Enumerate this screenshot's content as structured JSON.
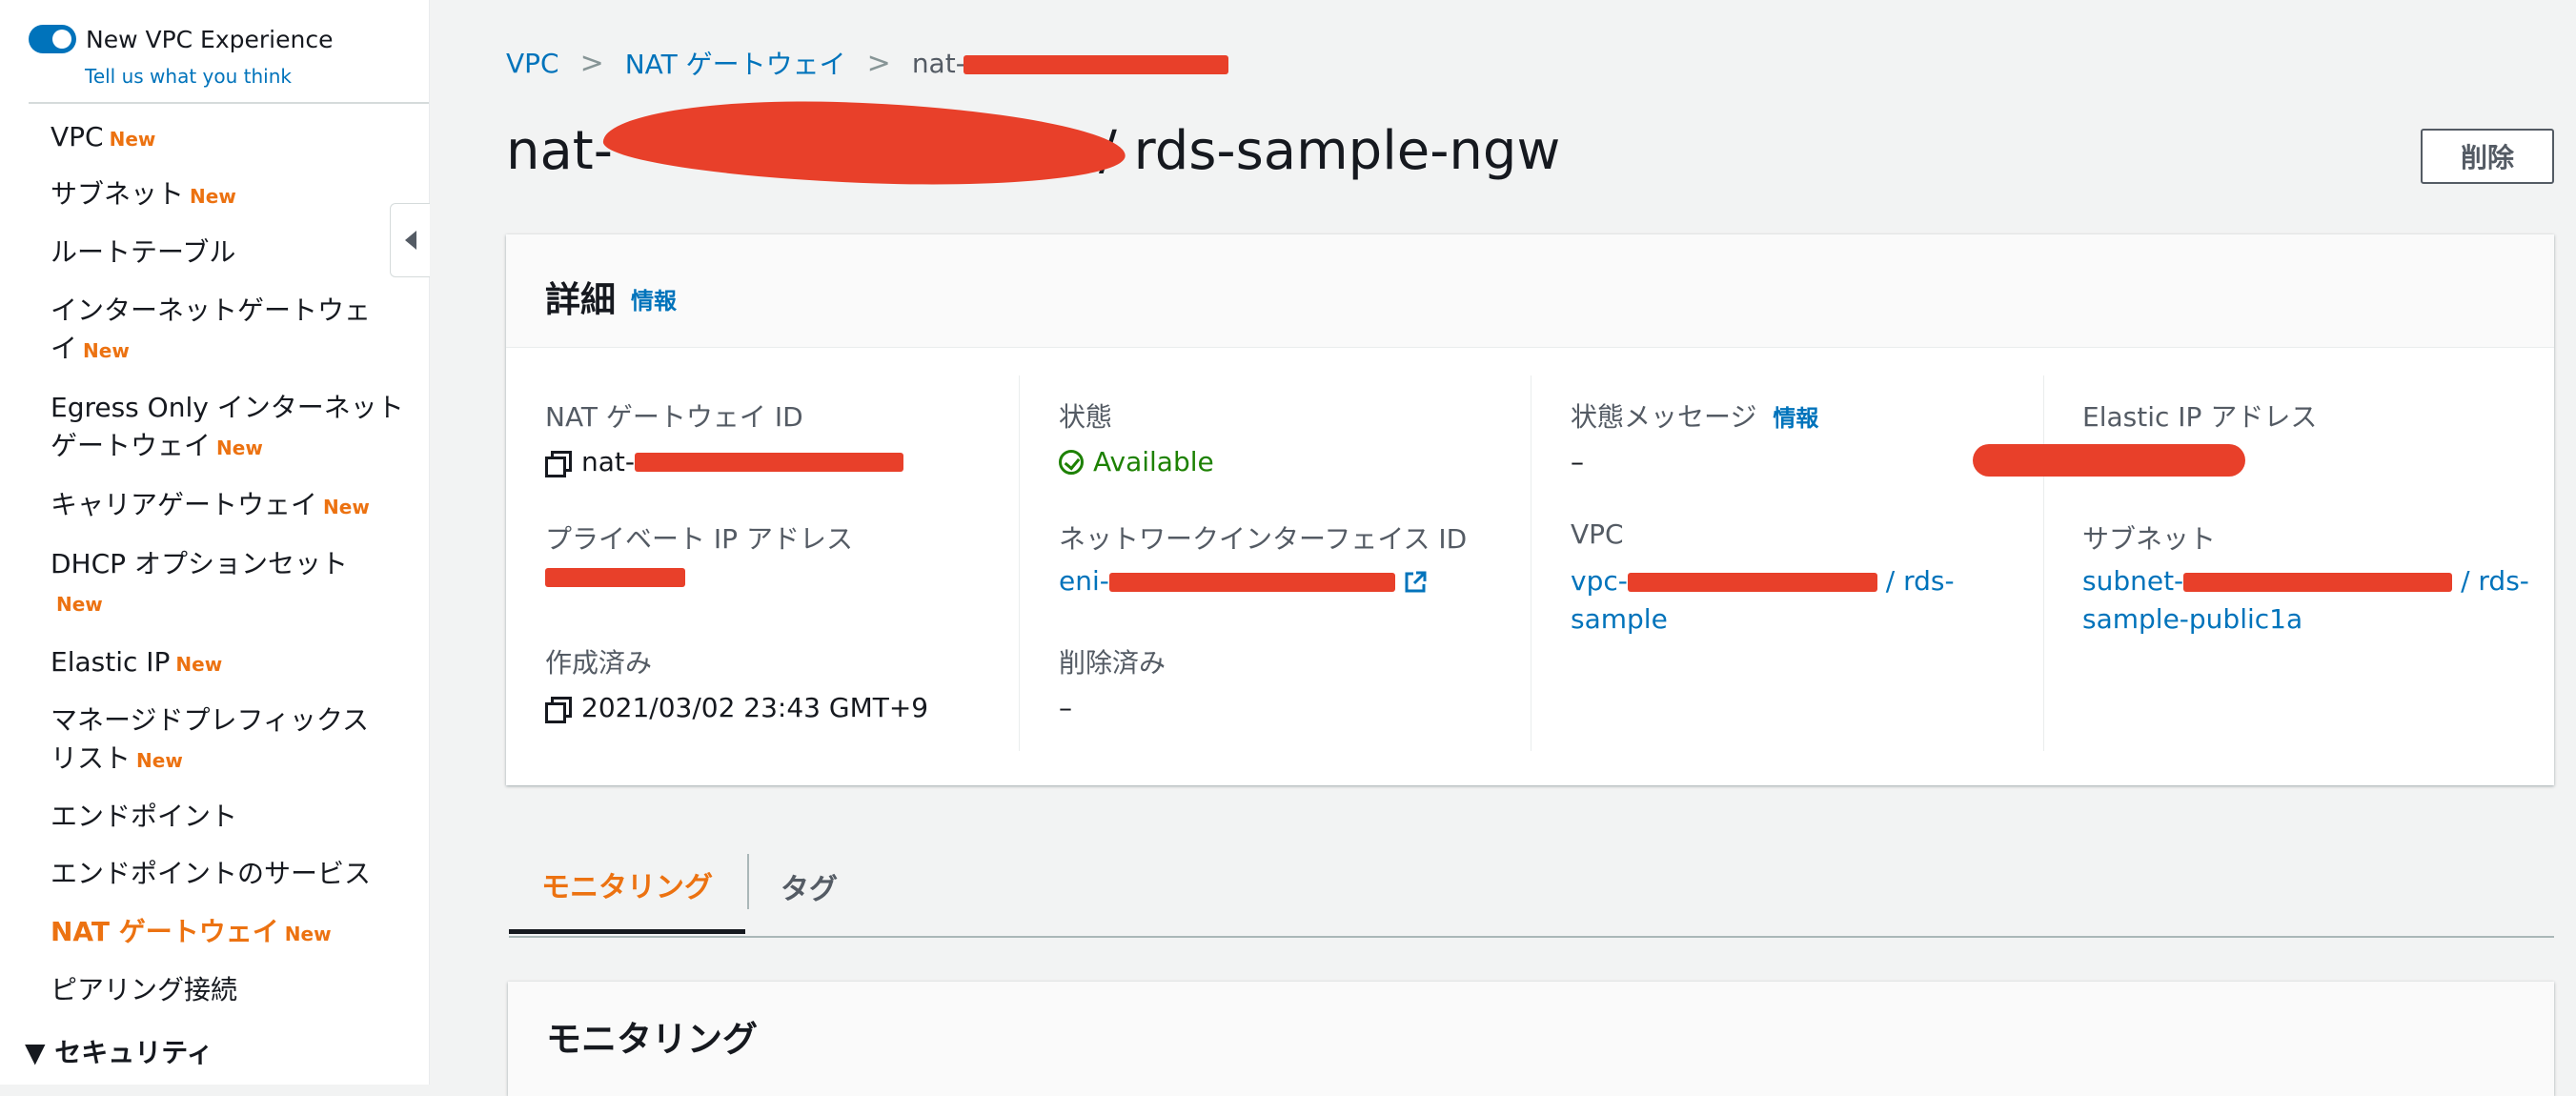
{
  "toggle": {
    "label": "New VPC Experience",
    "on": true,
    "feedback": "Tell us what you think"
  },
  "sidebar": {
    "new_badge": "New",
    "items": [
      {
        "label": "VPC",
        "new": true
      },
      {
        "label": "サブネット",
        "new": true
      },
      {
        "label": "ルートテーブル",
        "new": false
      },
      {
        "label": "インターネットゲートウェ",
        "label2": "イ",
        "new": true
      },
      {
        "label": "Egress Only インターネット",
        "label2": "ゲートウェイ",
        "new": true
      },
      {
        "label": "キャリアゲートウェイ",
        "new": true
      },
      {
        "label": "DHCP オプションセット",
        "new": true
      },
      {
        "label": "Elastic IP",
        "new": true
      },
      {
        "label": "マネージドプレフィックス",
        "label2": "リスト",
        "new": true
      },
      {
        "label": "エンドポイント",
        "new": false
      },
      {
        "label": "エンドポイントのサービス",
        "new": false
      },
      {
        "label": "NAT ゲートウェイ",
        "new": true,
        "active": true
      },
      {
        "label": "ピアリング接続",
        "new": false
      }
    ],
    "section": "▼ セキュリティ"
  },
  "breadcrumb": {
    "root": "VPC",
    "parent": "NAT ゲートウェイ",
    "current_prefix": "nat-"
  },
  "page": {
    "title_prefix": "nat-",
    "title_suffix": "/ rds-sample-ngw"
  },
  "actions": {
    "delete": "削除"
  },
  "details": {
    "title": "詳細",
    "info": "情報",
    "nat_id_label": "NAT ゲートウェイ ID",
    "nat_id_prefix": "nat-",
    "private_ip_label": "プライベート IP アドレス",
    "created_label": "作成済み",
    "created_value": "2021/03/02 23:43 GMT+9",
    "status_label": "状態",
    "status_value": "Available",
    "eni_label": "ネットワークインターフェイス ID",
    "eni_prefix": "eni-",
    "deleted_label": "削除済み",
    "deleted_value": "–",
    "status_msg_label": "状態メッセージ",
    "status_msg_info": "情報",
    "status_msg_value": "–",
    "vpc_label": "VPC",
    "vpc_prefix": "vpc-",
    "vpc_suffix": "/ rds-",
    "vpc_line2": "sample",
    "eip_label": "Elastic IP アドレス",
    "subnet_label": "サブネット",
    "subnet_prefix": "subnet-",
    "subnet_suffix": "/ rds-",
    "subnet_line2": "sample-public1a"
  },
  "tabs": [
    {
      "label": "モニタリング",
      "active": true
    },
    {
      "label": "タグ",
      "active": false
    }
  ],
  "monitoring": {
    "title": "モニタリング"
  },
  "colors": {
    "accent": "#ec7211",
    "link": "#0073bb",
    "success": "#1d8102",
    "redaction": "#e8402a"
  }
}
